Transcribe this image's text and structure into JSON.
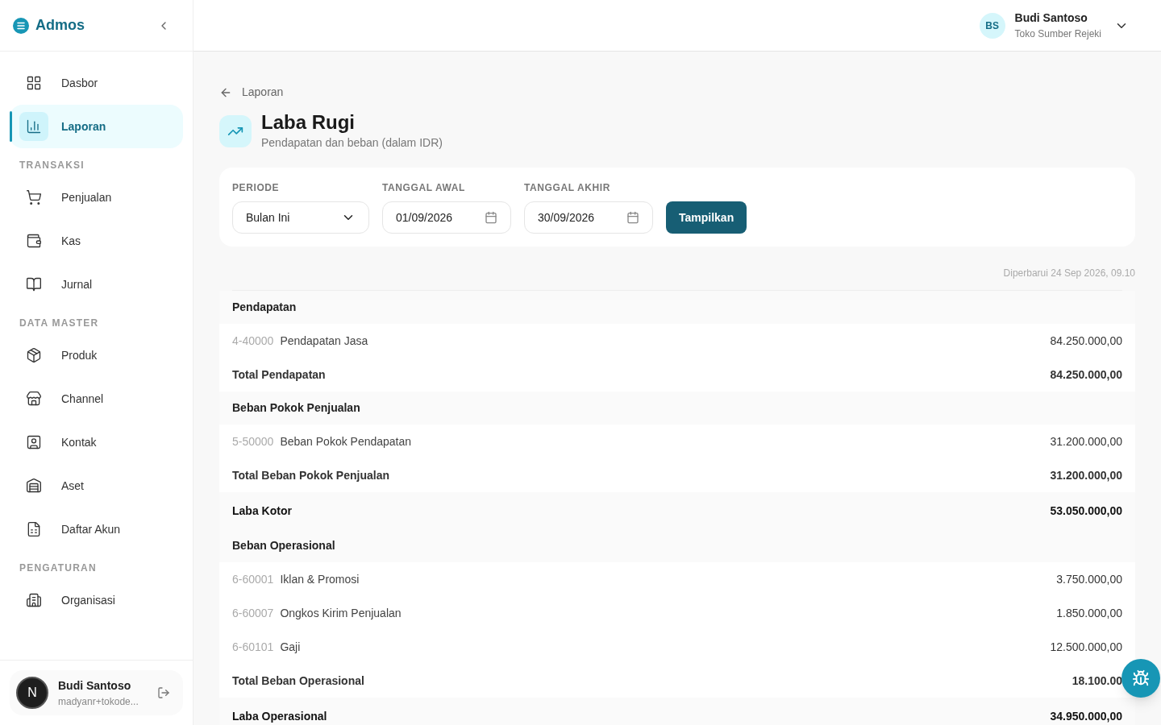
{
  "brand": {
    "name": "Admos"
  },
  "sidebar": {
    "groups": [
      {
        "items": [
          {
            "label": "Dasbor",
            "selected": false
          },
          {
            "label": "Laporan",
            "selected": true
          }
        ]
      },
      {
        "label": "TRANSAKSI",
        "items": [
          {
            "label": "Penjualan",
            "selected": false
          },
          {
            "label": "Kas",
            "selected": false
          },
          {
            "label": "Jurnal",
            "selected": false
          }
        ]
      },
      {
        "label": "DATA MASTER",
        "items": [
          {
            "label": "Produk",
            "selected": false
          },
          {
            "label": "Channel",
            "selected": false
          },
          {
            "label": "Kontak",
            "selected": false
          },
          {
            "label": "Aset",
            "selected": false
          },
          {
            "label": "Daftar Akun",
            "selected": false
          }
        ]
      },
      {
        "label": "PENGATURAN",
        "items": [
          {
            "label": "Organisasi",
            "selected": false
          }
        ]
      }
    ],
    "user": {
      "avatar": "N",
      "name": "Budi Santoso",
      "email": "madyanr+tokode..."
    }
  },
  "header": {
    "user": {
      "initials": "BS",
      "name": "Budi Santoso",
      "org": "Toko Sumber Rejeki"
    }
  },
  "breadcrumb": "Laporan",
  "page": {
    "title": "Laba Rugi",
    "subtitle": "Pendapatan dan beban (dalam IDR)"
  },
  "filters": {
    "period": {
      "label": "PERIODE",
      "value": "Bulan Ini"
    },
    "start": {
      "label": "TANGGAL AWAL",
      "value": "01/09/2026"
    },
    "end": {
      "label": "TANGGAL AKHIR",
      "value": "30/09/2026"
    },
    "button": "Tampilkan"
  },
  "updated": "Diperbarui 24 Sep 2026, 09.10",
  "rows": [
    {
      "kind": "section",
      "label": "Pendapatan"
    },
    {
      "kind": "account",
      "code": "4-40000",
      "label": "Pendapatan Jasa",
      "amount": "84.250.000,00"
    },
    {
      "kind": "total",
      "label": "Total Pendapatan",
      "amount": "84.250.000,00"
    },
    {
      "kind": "section",
      "label": "Beban Pokok Penjualan"
    },
    {
      "kind": "account",
      "code": "5-50000",
      "label": "Beban Pokok Pendapatan",
      "amount": "31.200.000,00"
    },
    {
      "kind": "total",
      "label": "Total Beban Pokok Penjualan",
      "amount": "31.200.000,00"
    },
    {
      "kind": "summary",
      "label": "Laba Kotor",
      "amount": "53.050.000,00"
    },
    {
      "kind": "section",
      "label": "Beban Operasional"
    },
    {
      "kind": "account",
      "code": "6-60001",
      "label": "Iklan & Promosi",
      "amount": "3.750.000,00"
    },
    {
      "kind": "account",
      "code": "6-60007",
      "label": "Ongkos Kirim Penjualan",
      "amount": "1.850.000,00"
    },
    {
      "kind": "account",
      "code": "6-60101",
      "label": "Gaji",
      "amount": "12.500.000,00"
    },
    {
      "kind": "total",
      "label": "Total Beban Operasional",
      "amount": "18.100.00"
    },
    {
      "kind": "summary",
      "label": "Laba Operasional",
      "amount": "34.950.000,00"
    }
  ]
}
